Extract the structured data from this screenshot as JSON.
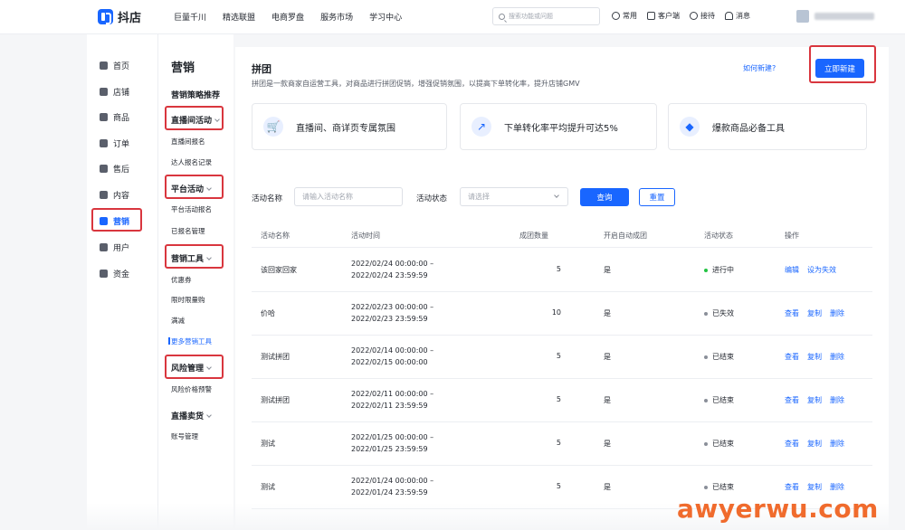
{
  "app": {
    "name": "抖店"
  },
  "topnav": [
    "巨量千川",
    "精选联盟",
    "电商罗盘",
    "服务市场",
    "学习中心"
  ],
  "search": {
    "placeholder": "搜索功能或问题"
  },
  "tools": [
    {
      "label": "常用",
      "icon": "clock-icon"
    },
    {
      "label": "客户端",
      "icon": "monitor-icon"
    },
    {
      "label": "接待",
      "icon": "headset-icon"
    },
    {
      "label": "消息",
      "icon": "bell-icon"
    }
  ],
  "mainnav": [
    {
      "label": "首页",
      "icon": "home-icon"
    },
    {
      "label": "店铺",
      "icon": "store-icon"
    },
    {
      "label": "商品",
      "icon": "goods-icon"
    },
    {
      "label": "订单",
      "icon": "order-icon"
    },
    {
      "label": "售后",
      "icon": "aftersale-icon"
    },
    {
      "label": "内容",
      "icon": "content-icon"
    },
    {
      "label": "营销",
      "icon": "marketing-icon",
      "active": true
    },
    {
      "label": "用户",
      "icon": "user-icon"
    },
    {
      "label": "资金",
      "icon": "wallet-icon"
    }
  ],
  "subnav": {
    "title": "营销",
    "recommend": "营销策略推荐",
    "groups": [
      {
        "label": "直播间活动",
        "items": [
          "直播间报名",
          "达人报名记录"
        ]
      },
      {
        "label": "平台活动",
        "items": [
          "平台活动报名",
          "已报名管理"
        ]
      },
      {
        "label": "营销工具",
        "items": [
          "优惠券",
          "限时限量购",
          "满减",
          "更多营销工具"
        ]
      },
      {
        "label": "风险管理",
        "items": [
          "风险价格预警"
        ]
      },
      {
        "label": "直播卖货",
        "items": [
          "账号管理"
        ]
      }
    ]
  },
  "page": {
    "title": "拼团",
    "description": "拼团是一款商家自运营工具，对商品进行拼团促销，增强促销氛围，以提高下单转化率，提升店铺GMV",
    "howto": "如何新建?",
    "new_button": "立即新建"
  },
  "features": [
    {
      "text": "直播间、商详页专属氛围",
      "icon": "cart-icon"
    },
    {
      "text": "下单转化率平均提升可达5%",
      "icon": "chart-up-icon"
    },
    {
      "text": "爆款商品必备工具",
      "icon": "bag-icon"
    }
  ],
  "filters": {
    "name_label": "活动名称",
    "name_placeholder": "请输入活动名称",
    "status_label": "活动状态",
    "status_placeholder": "请选择",
    "query": "查询",
    "reset": "重置"
  },
  "table": {
    "columns": [
      "活动名称",
      "活动时间",
      "成团数量",
      "开启自动成团",
      "活动状态",
      "操作"
    ],
    "rows": [
      {
        "name": "该回家回家",
        "start": "2022/02/24 00:00:00 –",
        "end": "2022/02/24 23:59:59",
        "count": "5",
        "auto": "是",
        "status": "进行中",
        "active": true,
        "ops": [
          "编辑",
          "设为失效"
        ]
      },
      {
        "name": "价哈",
        "start": "2022/02/23 00:00:00 –",
        "end": "2022/02/23 23:59:59",
        "count": "10",
        "auto": "是",
        "status": "已失效",
        "active": false,
        "ops": [
          "查看",
          "复制",
          "删除"
        ]
      },
      {
        "name": "测试拼团",
        "start": "2022/02/14 00:00:00 –",
        "end": "2022/02/15 00:00:00",
        "count": "5",
        "auto": "是",
        "status": "已结束",
        "active": false,
        "ops": [
          "查看",
          "复制",
          "删除"
        ]
      },
      {
        "name": "测试拼团",
        "start": "2022/02/11 00:00:00 –",
        "end": "2022/02/11 23:59:59",
        "count": "5",
        "auto": "是",
        "status": "已结束",
        "active": false,
        "ops": [
          "查看",
          "复制",
          "删除"
        ]
      },
      {
        "name": "测试",
        "start": "2022/01/25 00:00:00 –",
        "end": "2022/01/25 23:59:59",
        "count": "5",
        "auto": "是",
        "status": "已结束",
        "active": false,
        "ops": [
          "查看",
          "复制",
          "删除"
        ]
      },
      {
        "name": "测试",
        "start": "2022/01/24 00:00:00 –",
        "end": "2022/01/24 23:59:59",
        "count": "5",
        "auto": "是",
        "status": "已结束",
        "active": false,
        "ops": [
          "查看",
          "复制",
          "删除"
        ]
      }
    ]
  },
  "watermark": "awyerwu.com",
  "colors": {
    "accent": "#1966ff",
    "highlight": "#d9363e",
    "active_dot": "#23c343"
  }
}
